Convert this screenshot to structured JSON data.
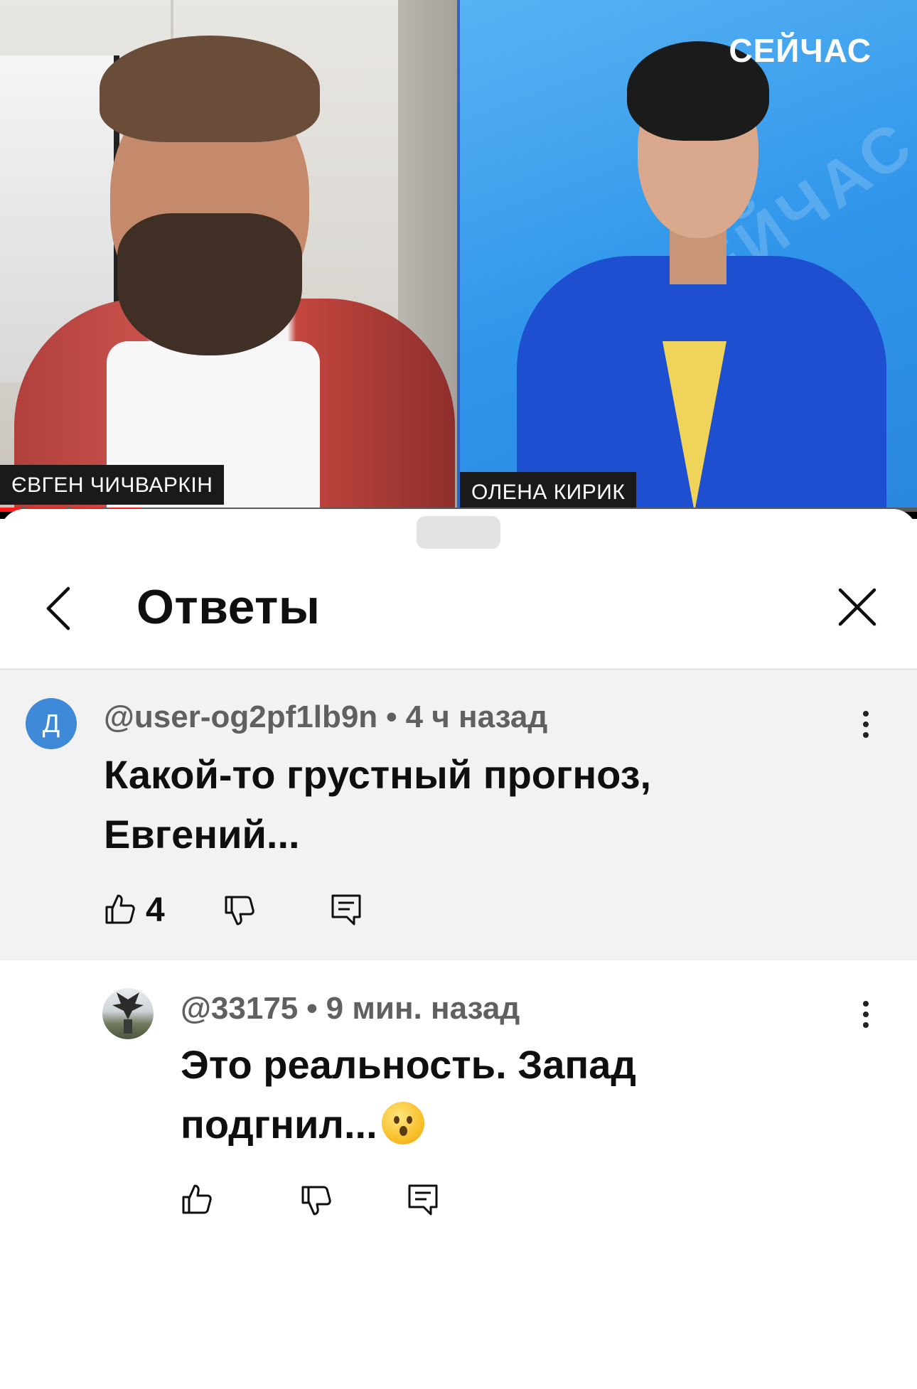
{
  "video": {
    "channel_logo": "СЕЙЧАС",
    "left_name": "ЄВГЕН ЧИЧВАРКІН",
    "right_name": "ОЛЕНА КИРИК",
    "background_watermark": "СЕЙЧАС"
  },
  "sheet": {
    "title": "Ответы"
  },
  "parent_comment": {
    "avatar_letter": "Д",
    "author": "@user-og2pf1lb9n",
    "time": "4 ч назад",
    "text_line1": "Какой-то грустный прогноз,",
    "text_line2": "Евгений...",
    "likes": "4"
  },
  "reply": {
    "author": "@33175",
    "time": "9 мин. назад",
    "text_line1": "Это реальность. Запад",
    "text_line2": "подгнил..."
  },
  "separator": "•",
  "colors": {
    "accent_red": "#ff1a1a",
    "avatar_blue": "#3f8ad8",
    "highlight_bg": "#f2f2f2",
    "meta_gray": "#606060"
  },
  "icons": [
    "back-chevron-icon",
    "close-icon",
    "more-vertical-icon",
    "thumb-up-icon",
    "thumb-down-icon",
    "reply-icon",
    "emoji-surprised-icon"
  ]
}
